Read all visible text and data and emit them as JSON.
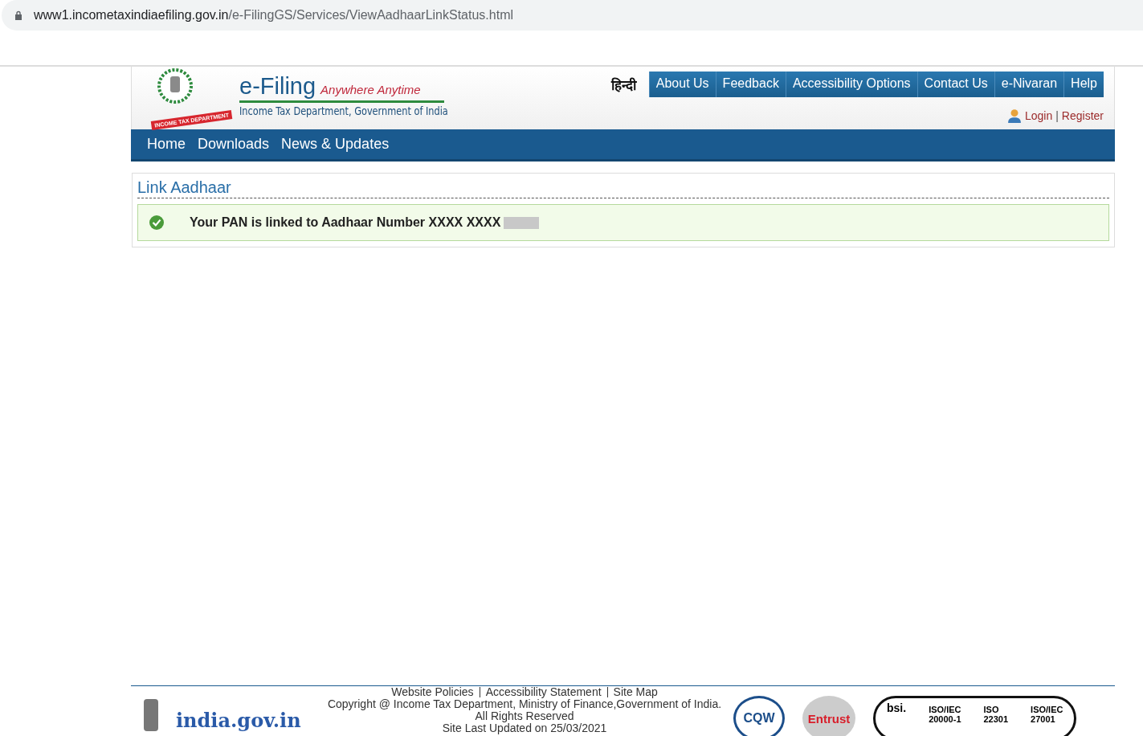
{
  "address_bar": {
    "host": "www1.incometaxindiaefiling.gov.in",
    "path": "/e-FilingGS/Services/ViewAadhaarLinkStatus.html"
  },
  "header": {
    "logo_ribbon": "INCOME TAX DEPARTMENT",
    "brand": "e-Filing",
    "tagline": "Anywhere Anytime",
    "subtitle": "Income Tax Department, Government of India",
    "language_link": "हिन्दी",
    "top_menu": [
      "About Us",
      "Feedback",
      "Accessibility Options",
      "Contact Us",
      "e-Nivaran",
      "Help"
    ],
    "login": "Login",
    "separator": "|",
    "register": "Register"
  },
  "main_nav": [
    "Home",
    "Downloads",
    "News & Updates"
  ],
  "panel": {
    "title": "Link Aadhaar",
    "message": "Your PAN is linked to Aadhaar Number XXXX XXXX"
  },
  "footer": {
    "links": [
      "Website Policies",
      "Accessibility Statement",
      "Site Map"
    ],
    "copyright": "Copyright @ Income Tax Department, Ministry of Finance,Government of India.",
    "rights": "All Rights Reserved",
    "updated": "Site Last Updated on 25/03/2021",
    "portal": "india.gov.in",
    "badges": [
      {
        "kind": "cqw",
        "text": "CQW"
      },
      {
        "kind": "entrust",
        "text": "Entrust"
      }
    ],
    "iso": {
      "brand": "bsi.",
      "certs": [
        {
          "title": "ISO/IEC",
          "number": "20000-1"
        },
        {
          "title": "ISO",
          "number": "22301"
        },
        {
          "title": "ISO/IEC",
          "number": "27001"
        }
      ]
    }
  }
}
